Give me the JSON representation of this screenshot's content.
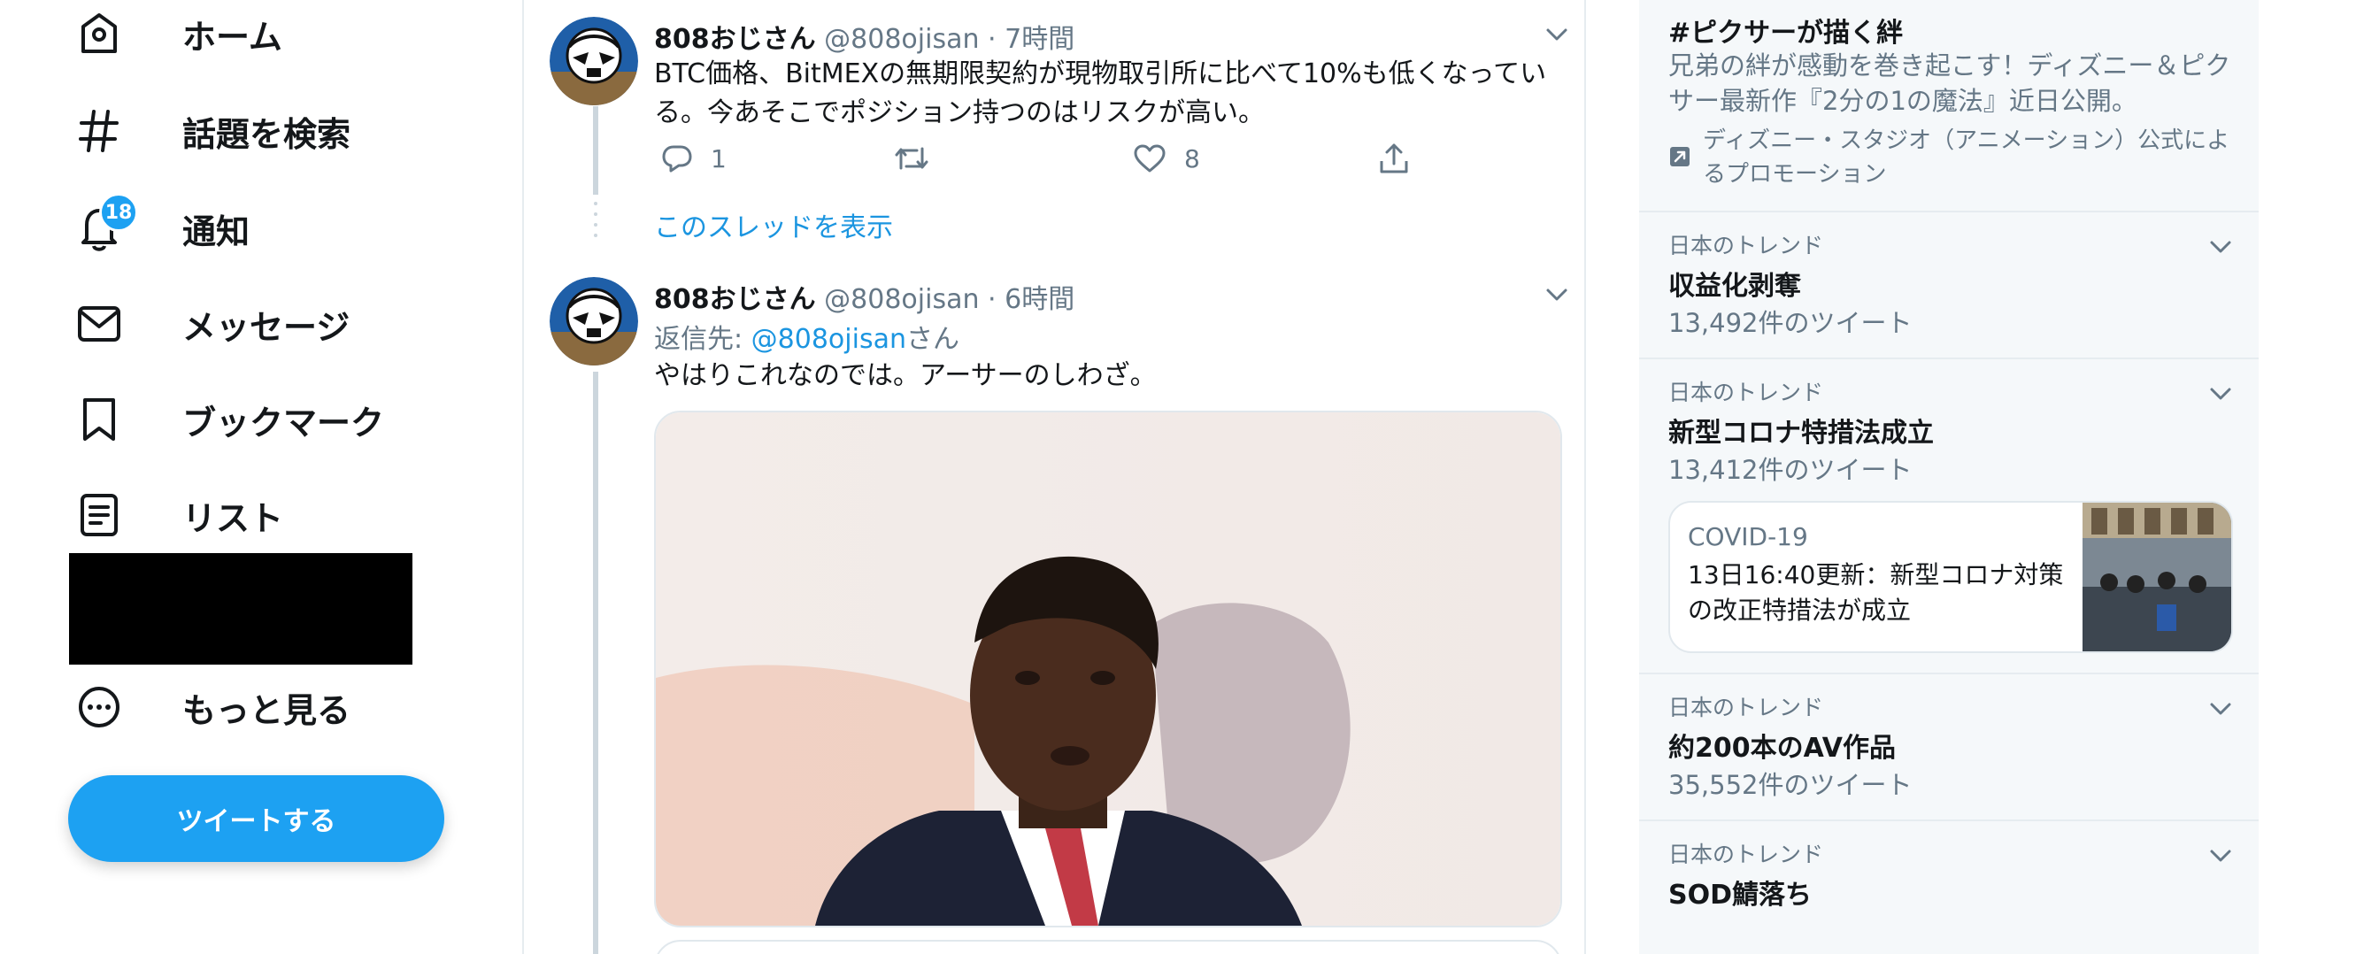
{
  "sidebar": {
    "items": [
      {
        "label": "ホーム",
        "icon": "home-icon"
      },
      {
        "label": "話題を検索",
        "icon": "hashtag-icon"
      },
      {
        "label": "通知",
        "icon": "bell-icon",
        "badge": "18"
      },
      {
        "label": "メッセージ",
        "icon": "envelope-icon"
      },
      {
        "label": "ブックマーク",
        "icon": "bookmark-icon"
      },
      {
        "label": "リスト",
        "icon": "list-icon"
      },
      {
        "label": "もっと見る",
        "icon": "more-circle-icon"
      }
    ],
    "tweet_button": "ツイートする"
  },
  "timeline": {
    "tweets": [
      {
        "name": "808おじさん",
        "handle": "@808ojisan",
        "time": "· 7時間",
        "text": "BTC価格、BitMEXの無期限契約が現物取引所に比べて10%も低くなっている。今あそこでポジション持つのはリスクが高い。",
        "reply_count": "1",
        "like_count": "8"
      },
      {
        "name": "808おじさん",
        "handle": "@808ojisan",
        "time": "· 6時間",
        "reply_prefix": "返信先: ",
        "reply_handle": "@808ojisan",
        "reply_suffix": "さん",
        "text": "やはりこれなのでは。アーサーのしわざ。"
      }
    ],
    "show_thread": "このスレッドを表示"
  },
  "right": {
    "promo": {
      "title": "#ピクサーが描く絆",
      "description": "兄弟の絆が感動を巻き起こす！ディズニー＆ピクサー最新作『2分の1の魔法』近日公開。",
      "promoted_by": "ディズニー・スタジオ（アニメーション）公式によるプロモーション"
    },
    "trends": [
      {
        "context": "日本のトレンド",
        "topic": "収益化剥奪",
        "count": "13,492件のツイート"
      },
      {
        "context": "日本のトレンド",
        "topic": "新型コロナ特措法成立",
        "count": "13,412件のツイート"
      },
      {
        "context": "日本のトレンド",
        "topic": "約200本のAV作品",
        "count": "35,552件のツイート"
      },
      {
        "context": "日本のトレンド",
        "topic": "SOD鯖落ち"
      }
    ],
    "news": {
      "topic": "COVID-19",
      "headline": "13日16:40更新：新型コロナ対策の改正特措法が成立"
    }
  },
  "colors": {
    "accent": "#1da1f2",
    "link": "#1b95e0",
    "text_primary": "#14171a",
    "text_secondary": "#657786",
    "border": "#e6ecf0",
    "panel_bg": "#f5f8fa"
  }
}
